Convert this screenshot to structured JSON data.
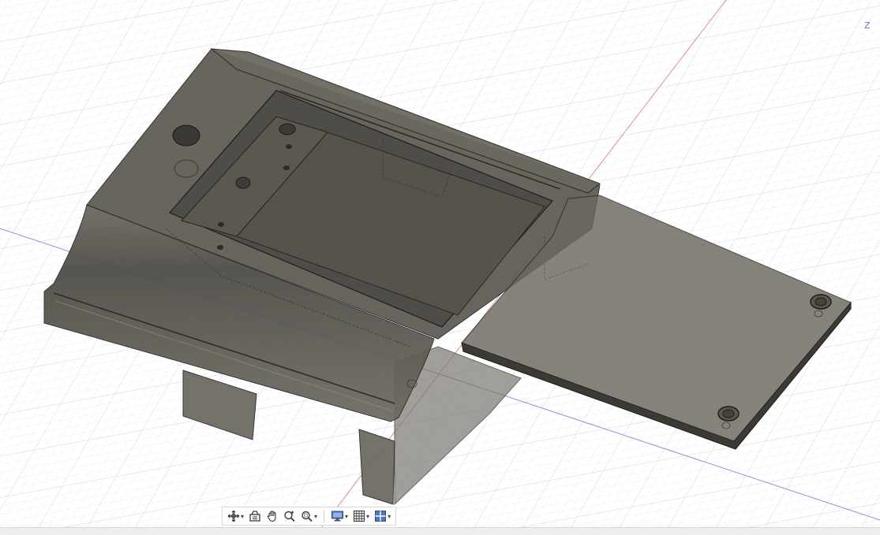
{
  "viewcube": {
    "axis_label": "Z"
  },
  "colors": {
    "grid_minor": "#e8ecf2",
    "grid_major": "#d3d9e3",
    "x_axis": "#d06060",
    "y_axis": "#5050cc",
    "body_fill": "#5d5a52",
    "body_top": "#66635a",
    "body_edge": "#2a2824",
    "toolbar_bg": "#ffffff"
  },
  "toolbar": {
    "buttons": [
      {
        "name": "orbit-button",
        "icon": "orbit-icon",
        "has_dropdown": true
      },
      {
        "name": "look-at-button",
        "icon": "look-at-icon",
        "has_dropdown": false
      },
      {
        "name": "pan-button",
        "icon": "hand-icon",
        "has_dropdown": false
      },
      {
        "name": "zoom-button",
        "icon": "zoom-icon",
        "has_dropdown": false
      },
      {
        "name": "zoom-window-button",
        "icon": "zoom-window-icon",
        "has_dropdown": true
      },
      {
        "name": "display-settings-button",
        "icon": "monitor-icon",
        "has_dropdown": true
      },
      {
        "name": "grid-snap-button",
        "icon": "grid-icon",
        "has_dropdown": true
      },
      {
        "name": "viewports-button",
        "icon": "viewports-icon",
        "has_dropdown": true
      }
    ]
  }
}
